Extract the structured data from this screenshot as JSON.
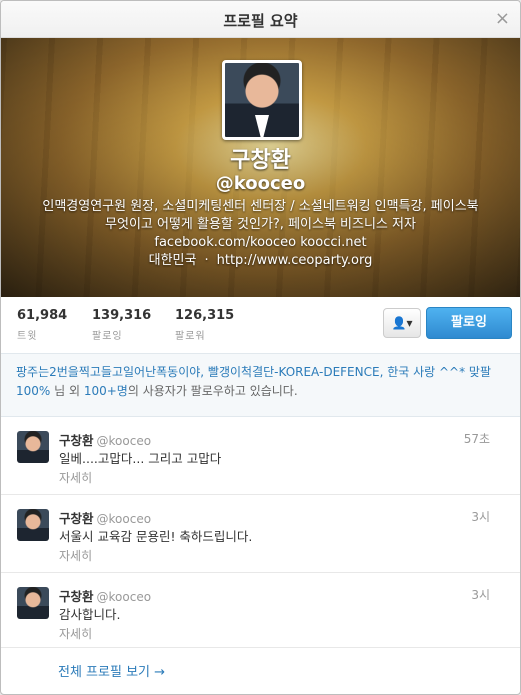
{
  "dialog": {
    "title": "프로필 요약",
    "close_label": "×"
  },
  "profile": {
    "name": "구창환",
    "handle": "@kooceo",
    "bio": "인맥경영연구원 원장, 소셜미케팅센터 센터장 / 소셜네트워킹 인맥특강, 페이스북 무엇이고 어떻게 활용할 것인가?, 페이스북 비즈니스 저자",
    "bio_links": "facebook.com/kooceo koocci.net",
    "location": "대한민국",
    "separator": "·",
    "url": "http://www.ceoparty.org"
  },
  "stats": [
    {
      "value": "61,984",
      "label": "트윗"
    },
    {
      "value": "139,316",
      "label": "팔로잉"
    },
    {
      "value": "126,315",
      "label": "팔로워"
    }
  ],
  "actions": {
    "user_menu_label": "👤▾",
    "follow_label": "팔로잉"
  },
  "followed_by": {
    "names": "팡주는2번을찍고들고일어난폭동이야, 빨갱이척결단-KOREA-DEFENCE, 한국 사랑 ^^* 맞팔100%",
    "middle": " 님 외 ",
    "count": "100+명",
    "suffix": "의 사용자가 팔로우하고 있습니다."
  },
  "tweets": [
    {
      "name": "구창환",
      "handle": "@kooceo",
      "time": "57초",
      "text": "일베....고맙다... 그리고 고맙다",
      "more": "자세히"
    },
    {
      "name": "구창환",
      "handle": "@kooceo",
      "time": "3시",
      "text": "서울시 교육감 문용린! 축하드립니다.",
      "more": "자세히"
    },
    {
      "name": "구창환",
      "handle": "@kooceo",
      "time": "3시",
      "text": "감사합니다.",
      "more": "자세히"
    }
  ],
  "footer": {
    "full_profile_label": "전체 프로필 보기 →"
  }
}
